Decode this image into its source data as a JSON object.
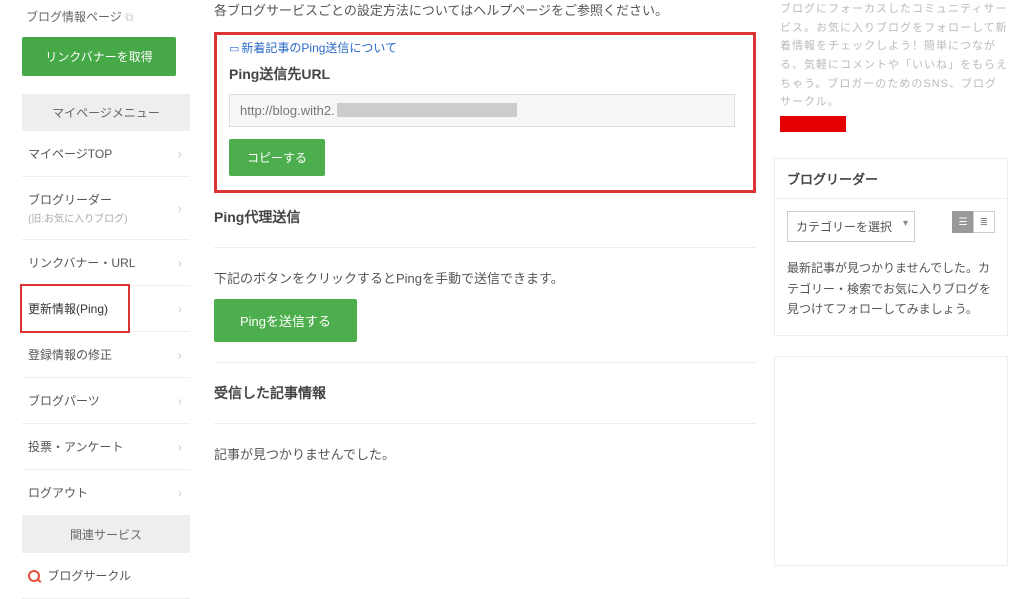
{
  "sidebar": {
    "blog_info_label": "ブログ情報ページ",
    "get_banner_btn": "リンクバナーを取得",
    "menu_header": "マイページメニュー",
    "items": [
      {
        "label": "マイページTOP",
        "sub": ""
      },
      {
        "label": "ブログリーダー",
        "sub": "(旧:お気に入りブログ)"
      },
      {
        "label": "リンクバナー・URL",
        "sub": ""
      },
      {
        "label": "更新情報(Ping)",
        "sub": ""
      },
      {
        "label": "登録情報の修正",
        "sub": ""
      },
      {
        "label": "ブログパーツ",
        "sub": ""
      },
      {
        "label": "投票・アンケート",
        "sub": ""
      },
      {
        "label": "ログアウト",
        "sub": ""
      }
    ],
    "related_header": "関連サービス",
    "blog_circle_label": "ブログサークル"
  },
  "main": {
    "intro_line": "各ブログサービスごとの設定方法についてはヘルプページをご参照ください。",
    "new_post_ping_link": "新着記事のPing送信について",
    "ping_url_title": "Ping送信先URL",
    "ping_url_value": "http://blog.with2.",
    "copy_btn": "コピーする",
    "proxy_title": "Ping代理送信",
    "proxy_desc": "下記のボタンをクリックするとPingを手動で送信できます。",
    "send_ping_btn": "Pingを送信する",
    "received_title": "受信した記事情報",
    "received_empty": "記事が見つかりませんでした。"
  },
  "right": {
    "promo_text": "ブログにフォーカスしたコミュニティサービス。お気に入りブログをフォローして新着情報をチェックしよう！簡単につながる、気軽にコメントや「いいね」をもらえちゃう。ブロガーのためのSNS、ブログサークル。",
    "reader_title": "ブログリーダー",
    "category_select": "カテゴリーを選択",
    "reader_empty": "最新記事が見つかりませんでした。カテゴリー・検索でお気に入りブログを見つけてフォローしてみましょう。"
  }
}
